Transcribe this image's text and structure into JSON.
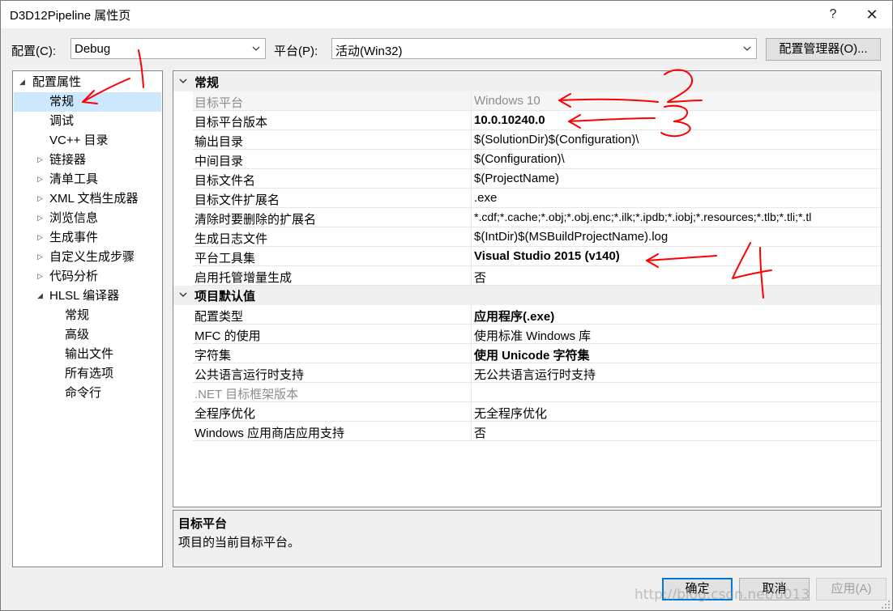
{
  "window": {
    "title": "D3D12Pipeline 属性页",
    "help_glyph": "?",
    "close_glyph": "✕"
  },
  "toolbar": {
    "config_label": "配置(C):",
    "config_value": "Debug",
    "platform_label": "平台(P):",
    "platform_value": "活动(Win32)",
    "config_manager_label": "配置管理器(O)..."
  },
  "tree": {
    "items": [
      {
        "label": "配置属性"
      },
      {
        "label": "常规"
      },
      {
        "label": "调试"
      },
      {
        "label": "VC++ 目录"
      },
      {
        "label": "链接器"
      },
      {
        "label": "清单工具"
      },
      {
        "label": "XML 文档生成器"
      },
      {
        "label": "浏览信息"
      },
      {
        "label": "生成事件"
      },
      {
        "label": "自定义生成步骤"
      },
      {
        "label": "代码分析"
      },
      {
        "label": "HLSL 编译器"
      },
      {
        "label": "常规"
      },
      {
        "label": "高级"
      },
      {
        "label": "输出文件"
      },
      {
        "label": "所有选项"
      },
      {
        "label": "命令行"
      }
    ]
  },
  "grid": {
    "categories": [
      {
        "name": "常规",
        "rows": [
          {
            "name": "目标平台",
            "value": "Windows 10"
          },
          {
            "name": "目标平台版本",
            "value": "10.0.10240.0"
          },
          {
            "name": "输出目录",
            "value": "$(SolutionDir)$(Configuration)\\"
          },
          {
            "name": "中间目录",
            "value": "$(Configuration)\\"
          },
          {
            "name": "目标文件名",
            "value": "$(ProjectName)"
          },
          {
            "name": "目标文件扩展名",
            "value": ".exe"
          },
          {
            "name": "清除时要删除的扩展名",
            "value": "*.cdf;*.cache;*.obj;*.obj.enc;*.ilk;*.ipdb;*.iobj;*.resources;*.tlb;*.tli;*.tl"
          },
          {
            "name": "生成日志文件",
            "value": "$(IntDir)$(MSBuildProjectName).log"
          },
          {
            "name": "平台工具集",
            "value": "Visual Studio 2015 (v140)"
          },
          {
            "name": "启用托管增量生成",
            "value": "否"
          }
        ]
      },
      {
        "name": "项目默认值",
        "rows": [
          {
            "name": "配置类型",
            "value": "应用程序(.exe)"
          },
          {
            "name": "MFC 的使用",
            "value": "使用标准 Windows 库"
          },
          {
            "name": "字符集",
            "value": "使用 Unicode 字符集"
          },
          {
            "name": "公共语言运行时支持",
            "value": "无公共语言运行时支持"
          },
          {
            "name": ".NET 目标框架版本",
            "value": ""
          },
          {
            "name": "全程序优化",
            "value": "无全程序优化"
          },
          {
            "name": "Windows 应用商店应用支持",
            "value": "否"
          }
        ]
      }
    ]
  },
  "description": {
    "title": "目标平台",
    "text": "项目的当前目标平台。"
  },
  "buttons": {
    "ok": "确定",
    "cancel": "取消",
    "apply": "应用(A)"
  },
  "watermark": "http://blog.csdn.net/u013",
  "annotations": [
    "1",
    "2",
    "3",
    "4"
  ],
  "colors": {
    "selection": "#cce8ff",
    "accent": "#0078d7",
    "annotation": "#ff0000"
  }
}
